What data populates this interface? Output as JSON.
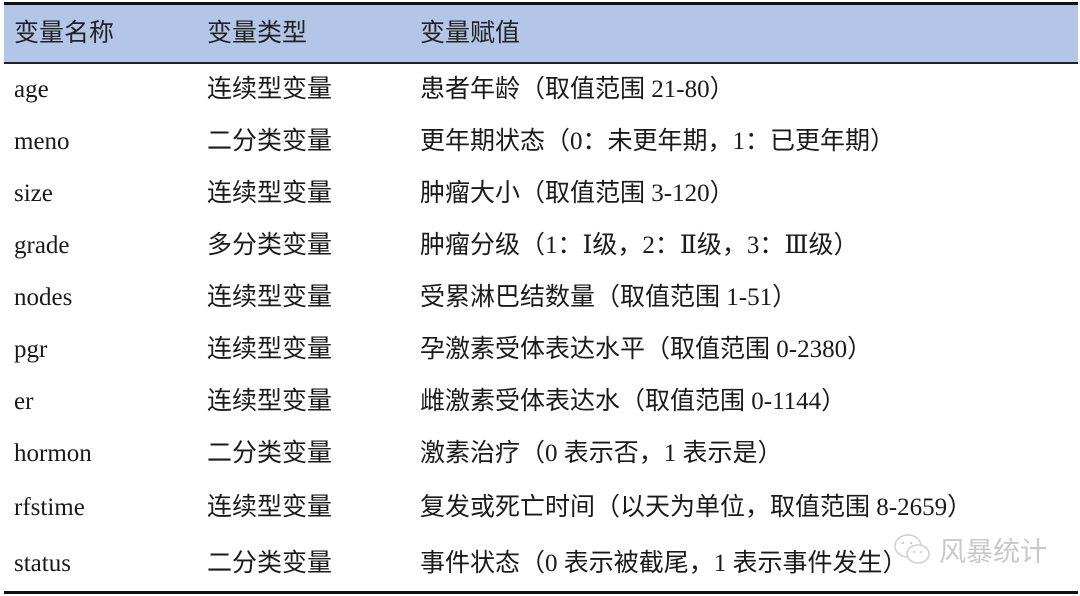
{
  "table": {
    "headers": [
      "变量名称",
      "变量类型",
      "变量赋值"
    ],
    "rows": [
      {
        "name": "age",
        "type": "连续型变量",
        "value": "患者年龄（取值范围 21-80）"
      },
      {
        "name": "meno",
        "type": "二分类变量",
        "value": "更年期状态（0：未更年期，1：已更年期）"
      },
      {
        "name": "size",
        "type": "连续型变量",
        "value": "肿瘤大小（取值范围 3-120）"
      },
      {
        "name": "grade",
        "type": "多分类变量",
        "value": "肿瘤分级（1：Ⅰ级，2：Ⅱ级，3：Ⅲ级）"
      },
      {
        "name": "nodes",
        "type": "连续型变量",
        "value": "受累淋巴结数量（取值范围 1-51）"
      },
      {
        "name": "pgr",
        "type": "连续型变量",
        "value": "孕激素受体表达水平（取值范围 0-2380）"
      },
      {
        "name": "er",
        "type": "连续型变量",
        "value": "雌激素受体表达水（取值范围 0-1144）"
      },
      {
        "name": "hormon",
        "type": "二分类变量",
        "value": "激素治疗（0 表示否，1 表示是）"
      },
      {
        "name": "rfstime",
        "type": "连续型变量",
        "value": "复发或死亡时间（以天为单位，取值范围 8-2659）"
      },
      {
        "name": "status",
        "type": "二分类变量",
        "value": "事件状态（0 表示被截尾，1 表示事件发生）"
      }
    ]
  },
  "watermark": {
    "text": "风暴统计",
    "icon": "wechat-icon"
  },
  "colors": {
    "header_bg": "#b4c6e7",
    "rule": "#111111",
    "watermark": "#c9c9c9"
  }
}
